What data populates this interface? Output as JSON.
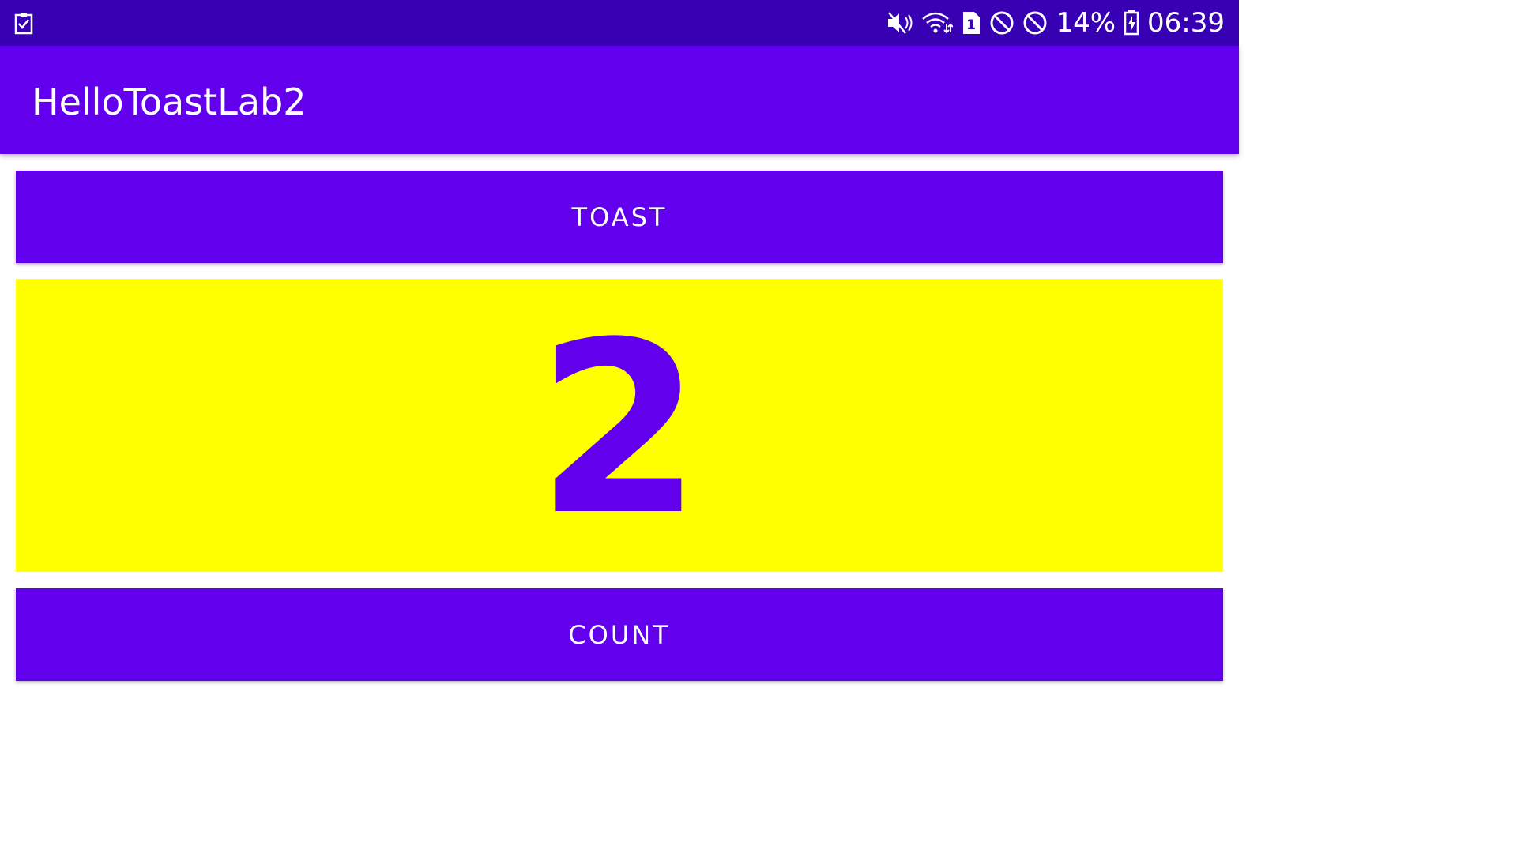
{
  "status_bar": {
    "left_icon": "task-check-icon",
    "icons": [
      "mute-icon",
      "wifi-icon",
      "sim-1-icon",
      "block-icon",
      "block-icon"
    ],
    "sim_label": "1",
    "battery_percent": "14%",
    "battery_icon": "battery-charging-icon",
    "time": "06:39"
  },
  "app_bar": {
    "title": "HelloToastLab2"
  },
  "toast_button": {
    "label": "TOAST"
  },
  "count_display": {
    "value": "2"
  },
  "count_button": {
    "label": "COUNT"
  },
  "colors": {
    "status_bar": "#3700B3",
    "primary": "#6200EE",
    "count_background": "#FFFF00",
    "on_primary": "#FFFFFF"
  }
}
